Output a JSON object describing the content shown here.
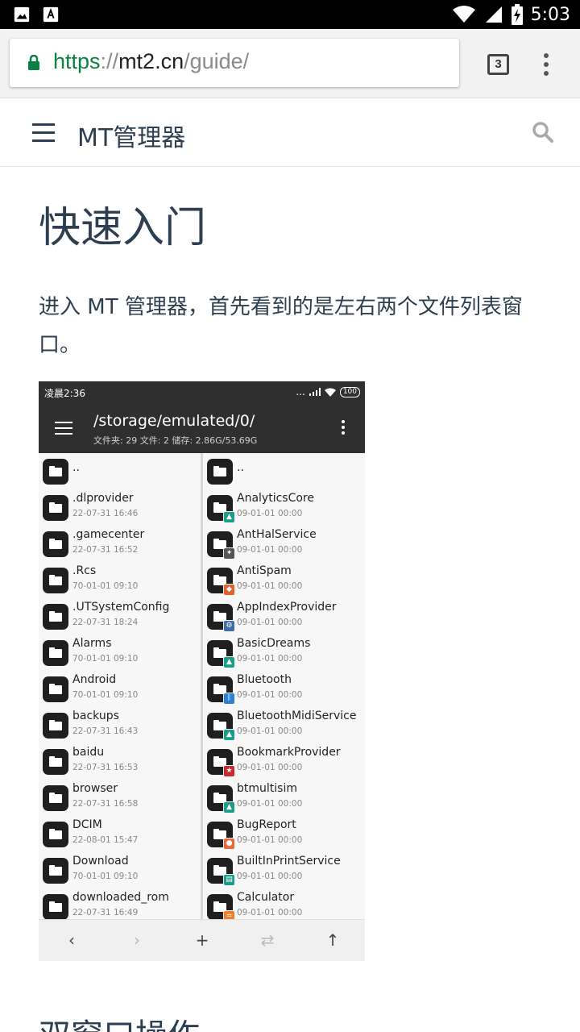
{
  "status_bar": {
    "time": "5:03",
    "left_icons": [
      "image-icon",
      "text-icon"
    ],
    "right_icons": [
      "wifi-icon",
      "signal-icon",
      "battery-charging-icon"
    ]
  },
  "browser": {
    "url_scheme": "https",
    "url_sep": "://",
    "url_host": "mt2.cn",
    "url_path": "/guide/",
    "tab_count": "3"
  },
  "site": {
    "title": "MT管理器"
  },
  "article": {
    "heading": "快速入门",
    "paragraph": "进入 MT 管理器，首先看到的是左右两个文件列表窗口。",
    "next_heading": "双窗口操作"
  },
  "screenshot": {
    "status_time": "凌晨2:36",
    "status_dots": "...",
    "battery": "100",
    "path": "/storage/emulated/0/",
    "summary": "文件夹: 29  文件: 2  储存: 2.86G/53.69G",
    "up_label": "..",
    "left_files": [
      {
        "name": ".dlprovider",
        "date": "22-07-31 16:46"
      },
      {
        "name": ".gamecenter",
        "date": "22-07-31 16:52"
      },
      {
        "name": ".Rcs",
        "date": "70-01-01 09:10"
      },
      {
        "name": ".UTSystemConfig",
        "date": "22-07-31 18:24"
      },
      {
        "name": "Alarms",
        "date": "70-01-01 09:10"
      },
      {
        "name": "Android",
        "date": "70-01-01 09:10"
      },
      {
        "name": "backups",
        "date": "22-07-31 16:43"
      },
      {
        "name": "baidu",
        "date": "22-07-31 16:53"
      },
      {
        "name": "browser",
        "date": "22-07-31 16:58"
      },
      {
        "name": "DCIM",
        "date": "22-08-01 15:47"
      },
      {
        "name": "Download",
        "date": "70-01-01 09:10"
      },
      {
        "name": "downloaded_rom",
        "date": "22-07-31 16:49"
      }
    ],
    "right_files": [
      {
        "name": "AnalyticsCore",
        "date": "09-01-01 00:00",
        "badge_color": "#1a9e8a",
        "badge_glyph": "▲"
      },
      {
        "name": "AntHalService",
        "date": "09-01-01 00:00",
        "badge_color": "#555555",
        "badge_glyph": "✦"
      },
      {
        "name": "AntiSpam",
        "date": "09-01-01 00:00",
        "badge_color": "#e0642c",
        "badge_glyph": "◆"
      },
      {
        "name": "AppIndexProvider",
        "date": "09-01-01 00:00",
        "badge_color": "#3f6ea8",
        "badge_glyph": "⚙"
      },
      {
        "name": "BasicDreams",
        "date": "09-01-01 00:00",
        "badge_color": "#1a9e8a",
        "badge_glyph": "▲"
      },
      {
        "name": "Bluetooth",
        "date": "09-01-01 00:00",
        "badge_color": "#2f7fd6",
        "badge_glyph": "ᛒ"
      },
      {
        "name": "BluetoothMidiService",
        "date": "09-01-01 00:00",
        "badge_color": "#1a9e8a",
        "badge_glyph": "▲"
      },
      {
        "name": "BookmarkProvider",
        "date": "09-01-01 00:00",
        "badge_color": "#cc2b2b",
        "badge_glyph": "★"
      },
      {
        "name": "btmultisim",
        "date": "09-01-01 00:00",
        "badge_color": "#1a9e8a",
        "badge_glyph": "▲"
      },
      {
        "name": "BugReport",
        "date": "09-01-01 00:00",
        "badge_color": "#e86a3a",
        "badge_glyph": "●"
      },
      {
        "name": "BuiltInPrintService",
        "date": "09-01-01 00:00",
        "badge_color": "#1a9e8a",
        "badge_glyph": "▤"
      },
      {
        "name": "Calculator",
        "date": "09-01-01 00:00",
        "badge_color": "#f07f2a",
        "badge_glyph": "="
      }
    ],
    "bottom_icons": [
      "back-arrow-icon",
      "forward-arrow-icon",
      "add-icon",
      "swap-icon",
      "up-arrow-icon"
    ]
  }
}
